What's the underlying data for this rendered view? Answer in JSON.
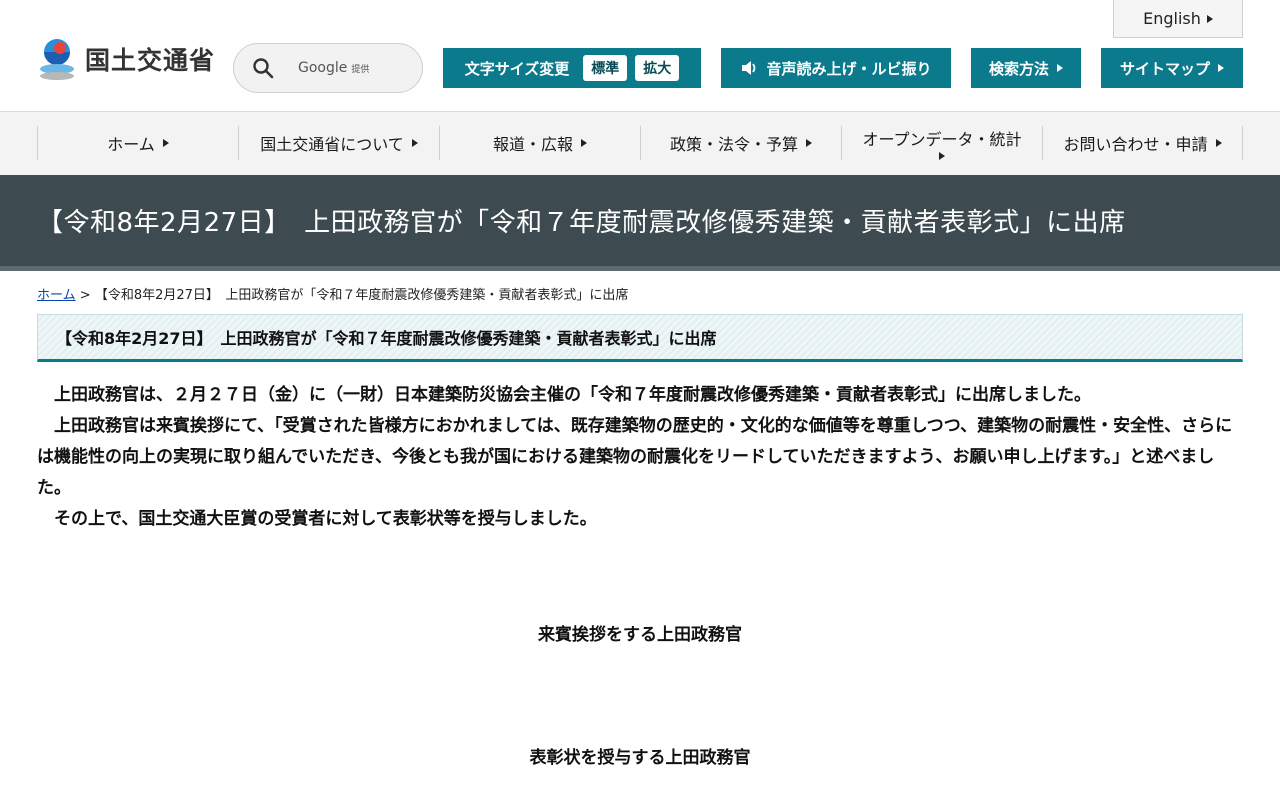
{
  "header": {
    "logo_text": "国土交通省",
    "search": {
      "provider": "Google",
      "provider_suffix": "提供"
    },
    "english_label": "English",
    "font_size": {
      "label": "文字サイズ変更",
      "standard": "標準",
      "enlarge": "拡大"
    },
    "voice_label": "音声読み上げ・ルビ振り",
    "search_method_label": "検索方法",
    "sitemap_label": "サイトマップ"
  },
  "gnav": {
    "items": [
      {
        "label": "ホーム"
      },
      {
        "label": "国土交通省について"
      },
      {
        "label": "報道・広報"
      },
      {
        "label": "政策・法令・予算"
      },
      {
        "label": "オープンデータ・統計"
      },
      {
        "label": "お問い合わせ・申請"
      }
    ]
  },
  "page": {
    "title": "【令和8年2月27日】　上田政務官が「令和７年度耐震改修優秀建築・貢献者表彰式」に出席",
    "breadcrumb": {
      "home": "ホーム",
      "separator": ">",
      "current": "【令和8年2月27日】　上田政務官が「令和７年度耐震改修優秀建築・貢献者表彰式」に出席"
    },
    "section_heading": "【令和8年2月27日】　上田政務官が「令和７年度耐震改修優秀建築・貢献者表彰式」に出席",
    "paragraphs": [
      "上田政務官は、２月２７日（金）に（一財）日本建築防災協会主催の「令和７年度耐震改修優秀建築・貢献者表彰式」に出席しました。",
      "上田政務官は来賓挨拶にて、「受賞された皆様方におかれましては、既存建築物の歴史的・文化的な価値等を尊重しつつ、建築物の耐震性・安全性、さらには機能性の向上の実現に取り組んでいただき、今後とも我が国における建築物の耐震化をリードしていただきますよう、お願い申し上げます。」と述べました。",
      "その上で、国土交通大臣賞の受賞者に対して表彰状等を授与しました。"
    ],
    "captions": [
      "来賓挨拶をする上田政務官",
      "表彰状を授与する上田政務官"
    ]
  },
  "colors": {
    "accent": "#0b7a8d",
    "title_band": "#3d4a50",
    "nav_bg": "#f3f3f3"
  }
}
